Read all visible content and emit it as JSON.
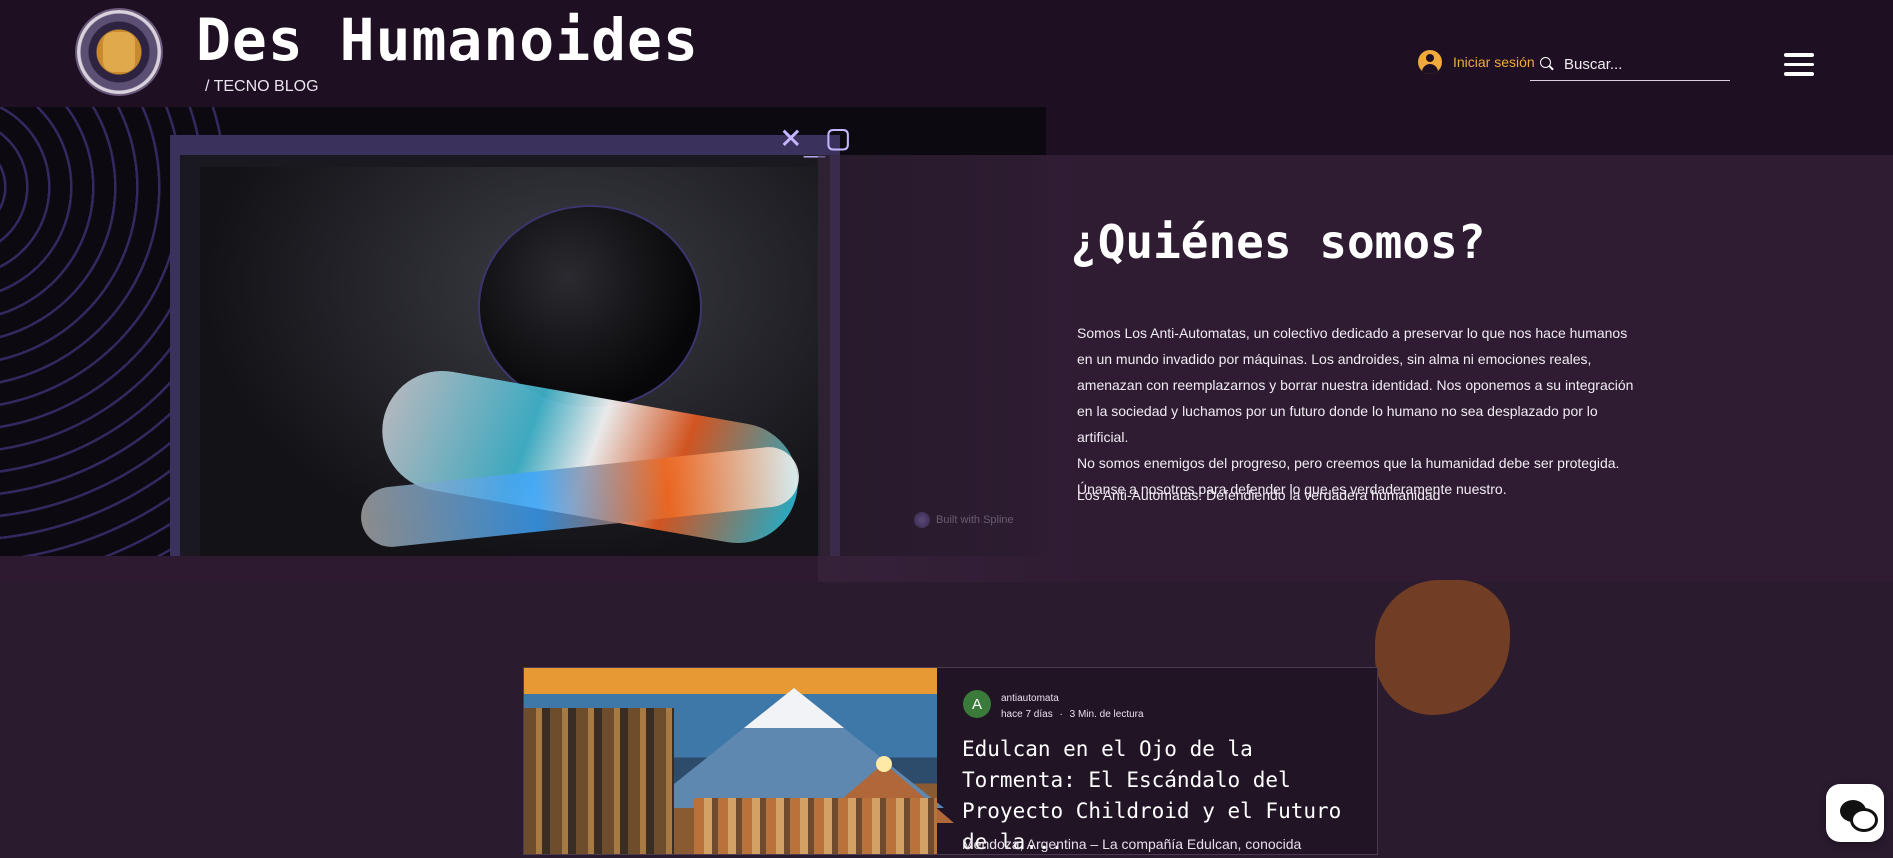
{
  "header": {
    "site_title": "Des Humanoides",
    "site_subtitle": "/ TECNO BLOG",
    "login_label": "Iniciar sesión",
    "search_placeholder": "Buscar..."
  },
  "hero": {
    "title": "¿Quiénes somos?",
    "paragraphs": [
      "Somos Los Anti-Automatas, un colectivo dedicado a preservar lo que nos hace humanos en un mundo invadido por máquinas. Los androides, sin alma ni emociones reales, amenazan con reemplazarnos y borrar nuestra identidad. Nos oponemos a su integración en la sociedad y luchamos por un futuro donde lo humano no sea desplazado por lo artificial.",
      "No somos enemigos del progreso, pero creemos que la humanidad debe ser protegida.",
      "Únanse a nosotros para defender lo que es verdaderamente nuestro."
    ],
    "tagline": "Los Anti-Automatas: Defendiendo la verdadera humanidad",
    "window_controls": "×_▢",
    "spline_badge": "Built with Spline"
  },
  "post": {
    "avatar_letter": "A",
    "author": "antiautomata",
    "time_ago": "hace 7 días",
    "separator": "·",
    "read_time": "3 Min. de lectura",
    "title": "Edulcan en el Ojo de la Tormenta: El Escándalo del Proyecto Childroid y el Futuro de la...",
    "excerpt": "Mendoza, Argentina – La compañía Edulcan, conocida"
  },
  "colors": {
    "header_bg": "#1e0f22",
    "page_bg": "#2a1b2f",
    "accent": "#f0a93a"
  },
  "icons": {
    "user": "user-icon",
    "search": "search-icon",
    "menu": "hamburger-icon",
    "chat": "chat-icon"
  }
}
